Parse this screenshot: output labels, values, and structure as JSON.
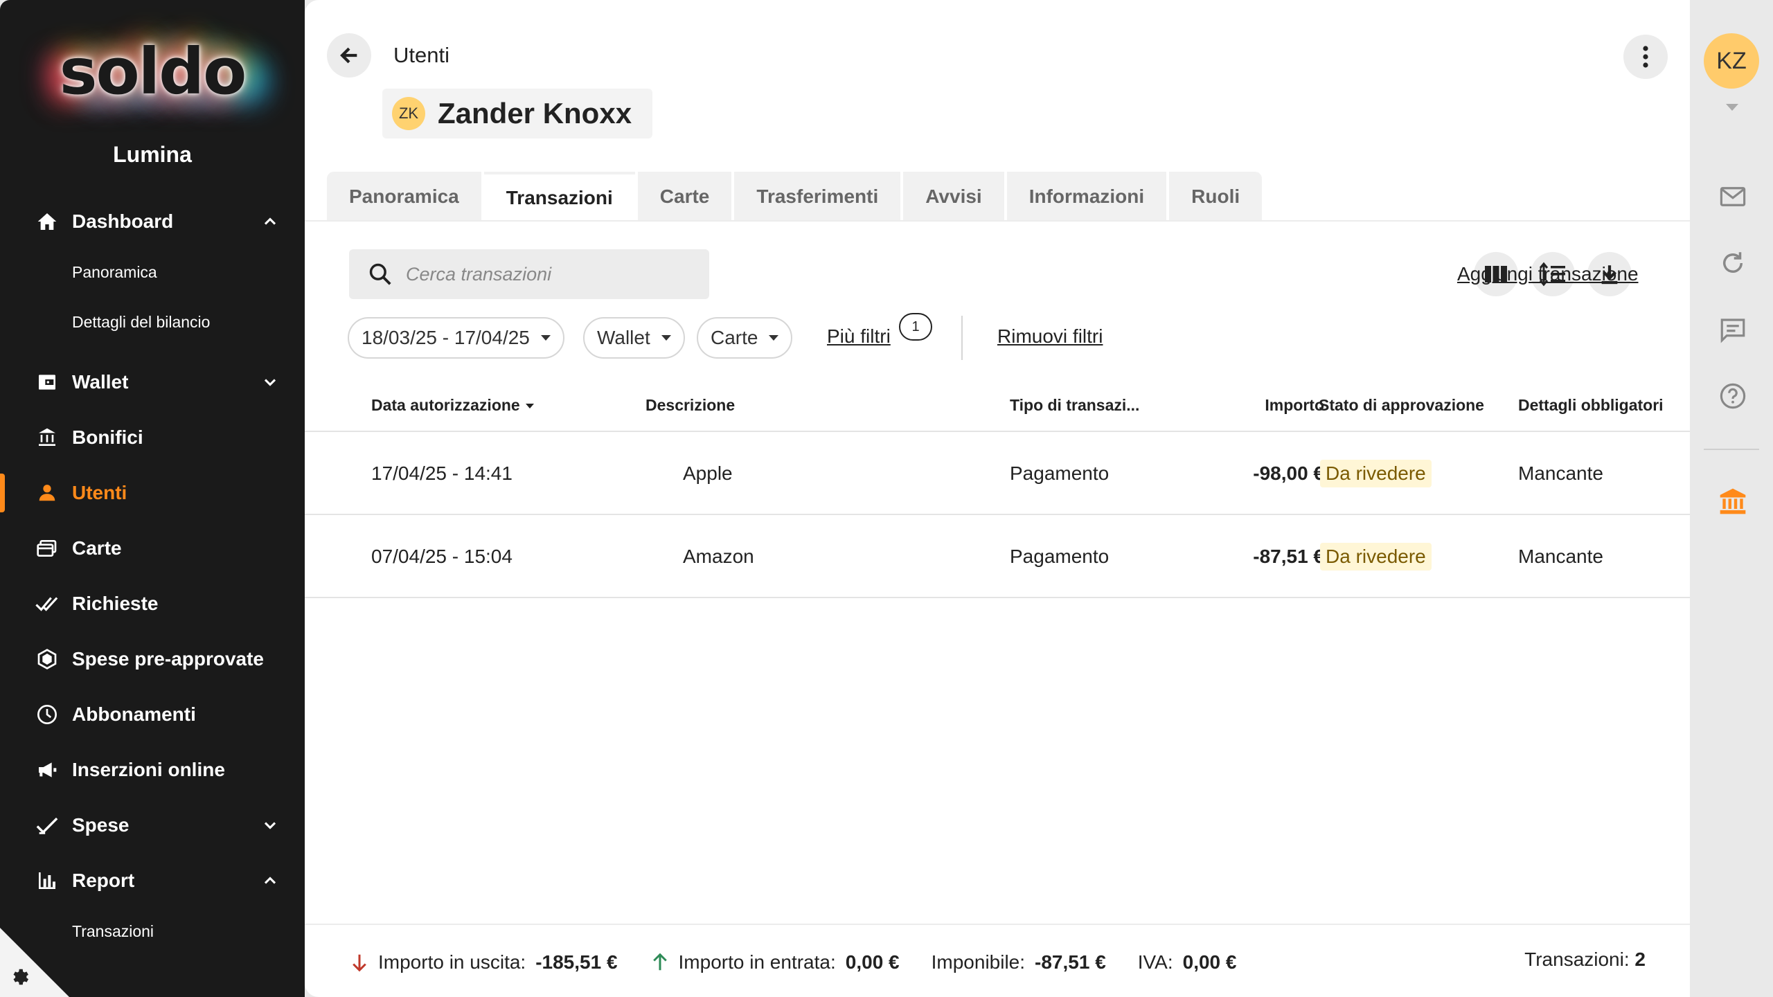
{
  "sidebar": {
    "logo": "soldo",
    "org_name": "Lumina",
    "items": [
      {
        "label": "Dashboard",
        "icon": "home-icon",
        "expanded": true
      },
      {
        "label": "Wallet",
        "icon": "wallet-icon",
        "expanded": false
      },
      {
        "label": "Bonifici",
        "icon": "bank-transfer-icon"
      },
      {
        "label": "Utenti",
        "icon": "user-icon",
        "active": true
      },
      {
        "label": "Carte",
        "icon": "cards-icon"
      },
      {
        "label": "Richieste",
        "icon": "double-check-icon"
      },
      {
        "label": "Spese pre-approvate",
        "icon": "hexagon-icon"
      },
      {
        "label": "Abbonamenti",
        "icon": "clock-icon"
      },
      {
        "label": "Inserzioni online",
        "icon": "megaphone-icon"
      },
      {
        "label": "Spese",
        "icon": "check-icon",
        "expanded": false
      },
      {
        "label": "Report",
        "icon": "bar-chart-icon",
        "expanded": true
      }
    ],
    "dashboard_sub": [
      "Panoramica",
      "Dettagli del bilancio"
    ],
    "report_sub": [
      "Transazioni"
    ]
  },
  "header": {
    "breadcrumb": "Utenti",
    "user_initials": "ZK",
    "user_name": "Zander Knoxx"
  },
  "tabs": [
    "Panoramica",
    "Transazioni",
    "Carte",
    "Trasferimenti",
    "Avvisi",
    "Informazioni",
    "Ruoli"
  ],
  "active_tab": "Transazioni",
  "toolbar": {
    "search_placeholder": "Cerca transazioni",
    "add_label": "Aggiungi transazione"
  },
  "filters": {
    "date_range": "18/03/25 - 17/04/25",
    "wallet": "Wallet",
    "cards": "Carte",
    "more": "Più filtri",
    "more_count": "1",
    "clear": "Rimuovi filtri"
  },
  "table": {
    "columns": [
      "Data autorizzazione",
      "Descrizione",
      "Tipo di transazi...",
      "Importo",
      "Stato di approvazione",
      "Dettagli obbligatori"
    ],
    "rows": [
      {
        "date": "17/04/25 - 14:41",
        "description": "Apple",
        "type": "Pagamento",
        "amount": "-98,00 €",
        "status": "Da rivedere",
        "details": "Mancante"
      },
      {
        "date": "07/04/25 - 15:04",
        "description": "Amazon",
        "type": "Pagamento",
        "amount": "-87,51 €",
        "status": "Da rivedere",
        "details": "Mancante"
      }
    ]
  },
  "footer": {
    "out_label": "Importo in uscita:",
    "out_value": "-185,51 €",
    "in_label": "Importo in entrata:",
    "in_value": "0,00 €",
    "taxable_label": "Imponibile:",
    "taxable_value": "-87,51 €",
    "vat_label": "IVA:",
    "vat_value": "0,00 €",
    "count_label": "Transazioni:",
    "count_value": "2"
  },
  "rail": {
    "user_initials": "KZ"
  },
  "colors": {
    "accent": "#ff8a1a",
    "sidebar_bg": "#1a1a1a",
    "status_bg": "#fff6d6",
    "out_arrow": "#c0392b",
    "in_arrow": "#2e8b57"
  }
}
